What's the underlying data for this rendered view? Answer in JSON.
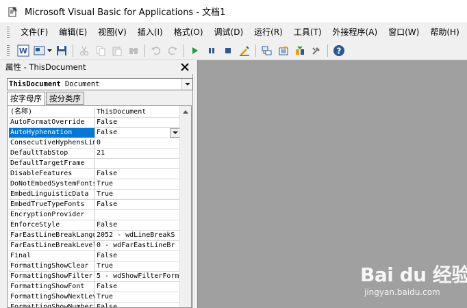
{
  "window": {
    "title": "Microsoft Visual Basic for Applications - 文档1"
  },
  "menu": [
    {
      "label": "文件(F)",
      "name": "menu-file"
    },
    {
      "label": "编辑(E)",
      "name": "menu-edit"
    },
    {
      "label": "视图(V)",
      "name": "menu-view"
    },
    {
      "label": "插入(I)",
      "name": "menu-insert"
    },
    {
      "label": "格式(O)",
      "name": "menu-format"
    },
    {
      "label": "调试(D)",
      "name": "menu-debug"
    },
    {
      "label": "运行(R)",
      "name": "menu-run"
    },
    {
      "label": "工具(T)",
      "name": "menu-tools"
    },
    {
      "label": "外接程序(A)",
      "name": "menu-addins"
    },
    {
      "label": "窗口(W)",
      "name": "menu-window"
    },
    {
      "label": "帮助(H)",
      "name": "menu-help"
    }
  ],
  "toolbar": {
    "icons": [
      "word-icon",
      "insert-module-icon",
      "save-icon",
      "cut-icon",
      "copy-icon",
      "paste-icon",
      "find-icon",
      "undo-icon",
      "redo-icon",
      "run-icon",
      "break-icon",
      "reset-icon",
      "design-mode-icon",
      "project-explorer-icon",
      "properties-window-icon",
      "object-browser-icon",
      "toolbox-icon",
      "help-icon"
    ]
  },
  "properties_panel": {
    "title": "属性 - ThisDocument",
    "object_name": "ThisDocument",
    "object_type": "Document",
    "tabs": [
      "按字母序",
      "按分类序"
    ],
    "rows": [
      {
        "name": "(名称)",
        "value": "ThisDocument"
      },
      {
        "name": "AutoFormatOverride",
        "value": "False"
      },
      {
        "name": "AutoHyphenation",
        "value": "False",
        "selected": true
      },
      {
        "name": "ConsecutiveHyphensLim",
        "value": "0"
      },
      {
        "name": "DefaultTabStop",
        "value": "21"
      },
      {
        "name": "DefaultTargetFrame",
        "value": ""
      },
      {
        "name": "DisableFeatures",
        "value": "False"
      },
      {
        "name": "DoNotEmbedSystemFonts",
        "value": "True"
      },
      {
        "name": "EmbedLinguisticData",
        "value": "True"
      },
      {
        "name": "EmbedTrueTypeFonts",
        "value": "False"
      },
      {
        "name": "EncryptionProvider",
        "value": ""
      },
      {
        "name": "EnforceStyle",
        "value": "False"
      },
      {
        "name": "FarEastLineBreakLangu",
        "value": "2052 - wdLineBreakS"
      },
      {
        "name": "FarEastLineBreakLevel",
        "value": "0 - wdFarEastLineBr"
      },
      {
        "name": "Final",
        "value": "False"
      },
      {
        "name": "FormattingShowClear",
        "value": "True"
      },
      {
        "name": "FormattingShowFilter",
        "value": "5 - wdShowFilterForm"
      },
      {
        "name": "FormattingShowFont",
        "value": "False"
      },
      {
        "name": "FormattingShowNextLev",
        "value": "True"
      },
      {
        "name": "FormattingShowNumberi",
        "value": "False"
      }
    ]
  },
  "watermark": {
    "logo": "Bai du 经验",
    "sub": "jingyan.baidu.com"
  },
  "colors": {
    "selection": "#0078d7",
    "mdi_background": "#a0a0a0"
  }
}
